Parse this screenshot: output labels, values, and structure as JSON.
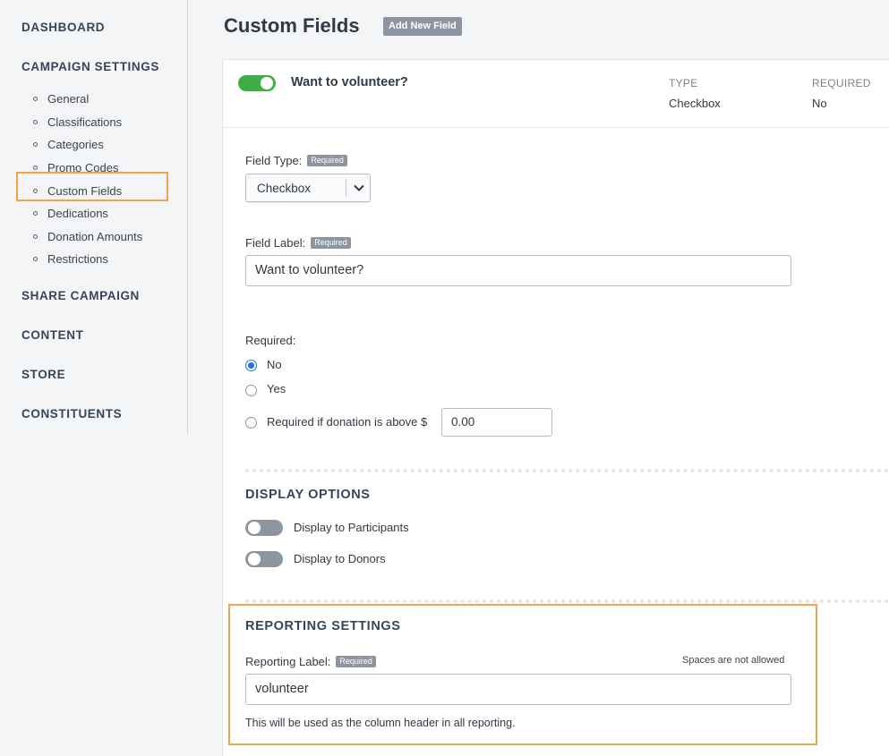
{
  "sidebar": {
    "headings": {
      "dashboard": "DASHBOARD",
      "campaign_settings": "CAMPAIGN SETTINGS",
      "share_campaign": "SHARE CAMPAIGN",
      "content": "CONTENT",
      "store": "STORE",
      "constituents": "CONSTITUENTS"
    },
    "items": [
      "General",
      "Classifications",
      "Categories",
      "Promo Codes",
      "Custom Fields",
      "Dedications",
      "Donation Amounts",
      "Restrictions"
    ],
    "active_item": "Custom Fields"
  },
  "header": {
    "title": "Custom Fields",
    "add_button": "Add New Field"
  },
  "field": {
    "name": "Want to volunteer?",
    "enabled": true,
    "type_heading": "TYPE",
    "type_value": "Checkbox",
    "required_heading": "REQUIRED",
    "required_value": "No"
  },
  "form": {
    "required_badge": "Required",
    "field_type_label": "Field Type:",
    "field_type_value": "Checkbox",
    "field_label_label": "Field Label:",
    "field_label_value": "Want to volunteer?",
    "required_label": "Required:",
    "required_options": [
      "No",
      "Yes",
      "Required if donation is above $"
    ],
    "required_selected": "No",
    "donation_threshold": "0.00"
  },
  "display_options": {
    "title": "DISPLAY OPTIONS",
    "participants": "Display to Participants",
    "participants_on": false,
    "donors": "Display to Donors",
    "donors_on": false
  },
  "reporting": {
    "title": "REPORTING SETTINGS",
    "label": "Reporting Label:",
    "note": "Spaces are not allowed",
    "value": "volunteer",
    "hint": "This will be used as the column header in all reporting."
  },
  "colors": {
    "accent_green": "#3fae49",
    "highlight_orange": "#f3a449",
    "radio_blue": "#1a73e8"
  }
}
